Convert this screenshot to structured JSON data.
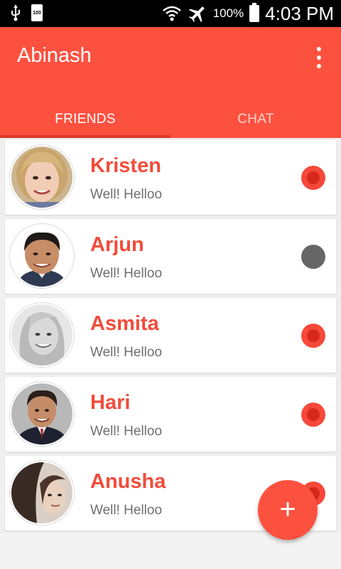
{
  "status_bar": {
    "time": "4:03 PM",
    "battery_percent": "100%",
    "box_label": "100",
    "icons": [
      "usb-icon",
      "sim-box-icon",
      "wifi-icon",
      "airplane-mode-icon",
      "battery-icon"
    ]
  },
  "app_bar": {
    "title": "Abinash",
    "menu_icon": "overflow-menu-icon",
    "color": "#fd5140"
  },
  "tabs": [
    {
      "label": "FRIENDS",
      "selected": true
    },
    {
      "label": "CHAT",
      "selected": false
    }
  ],
  "friends": [
    {
      "name": "Kristen",
      "message": "Well! Helloo",
      "status": "online"
    },
    {
      "name": "Arjun",
      "message": "Well! Helloo",
      "status": "offline"
    },
    {
      "name": "Asmita",
      "message": "Well! Helloo",
      "status": "online"
    },
    {
      "name": "Hari",
      "message": "Well! Helloo",
      "status": "online"
    },
    {
      "name": "Anusha",
      "message": "Well! Helloo",
      "status": "online"
    }
  ],
  "fab": {
    "label": "+",
    "icon": "add-icon"
  },
  "colors": {
    "accent": "#fd5140",
    "name_text": "#f24c3b",
    "online": "#f6493a",
    "offline": "#666666"
  }
}
